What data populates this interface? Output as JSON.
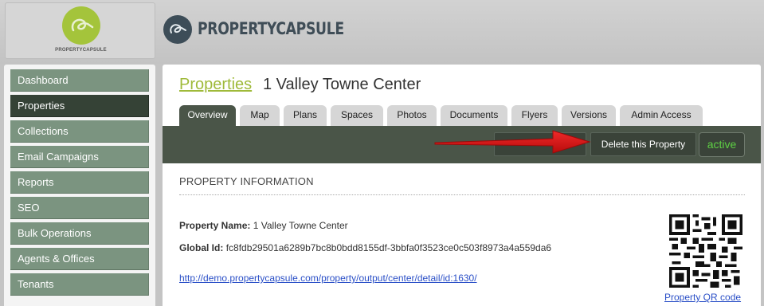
{
  "brand": {
    "logo_small_text": "PROPERTYCAPSULE",
    "name": "PROPERTYCAPSULE",
    "colors": {
      "green": "#a4c43b",
      "navy": "#3d4d58"
    }
  },
  "sidebar": {
    "items": [
      {
        "label": "Dashboard",
        "active": false
      },
      {
        "label": "Properties",
        "active": true
      },
      {
        "label": "Collections",
        "active": false
      },
      {
        "label": "Email Campaigns",
        "active": false
      },
      {
        "label": "Reports",
        "active": false
      },
      {
        "label": "SEO",
        "active": false
      },
      {
        "label": "Bulk Operations",
        "active": false
      },
      {
        "label": "Agents & Offices",
        "active": false
      },
      {
        "label": "Tenants",
        "active": false
      }
    ]
  },
  "page": {
    "breadcrumb_link": "Properties",
    "title": "1 Valley Towne Center"
  },
  "tabs": [
    {
      "label": "Overview",
      "active": true
    },
    {
      "label": "Map",
      "active": false
    },
    {
      "label": "Plans",
      "active": false
    },
    {
      "label": "Spaces",
      "active": false
    },
    {
      "label": "Photos",
      "active": false
    },
    {
      "label": "Documents",
      "active": false
    },
    {
      "label": "Flyers",
      "active": false
    },
    {
      "label": "Versions",
      "active": false
    },
    {
      "label": "Admin Access",
      "active": false
    }
  ],
  "toolbar": {
    "delete_label": "Delete this Property",
    "status_label": "active",
    "status_color": "#5ed044"
  },
  "info": {
    "section_title": "PROPERTY INFORMATION",
    "name_label": "Property Name:",
    "name_value": "1 Valley Towne Center",
    "global_id_label": "Global Id:",
    "global_id_value": "fc8fdb29501a6289b7bc8b0bdd8155df-3bbfa0f3523ce0c503f8973a4a559da6",
    "url": "http://demo.propertycapsule.com/property/output/center/detail/id:1630/",
    "qr_caption": "Property QR code"
  },
  "annotation": {
    "arrow_color": "#e01414"
  }
}
